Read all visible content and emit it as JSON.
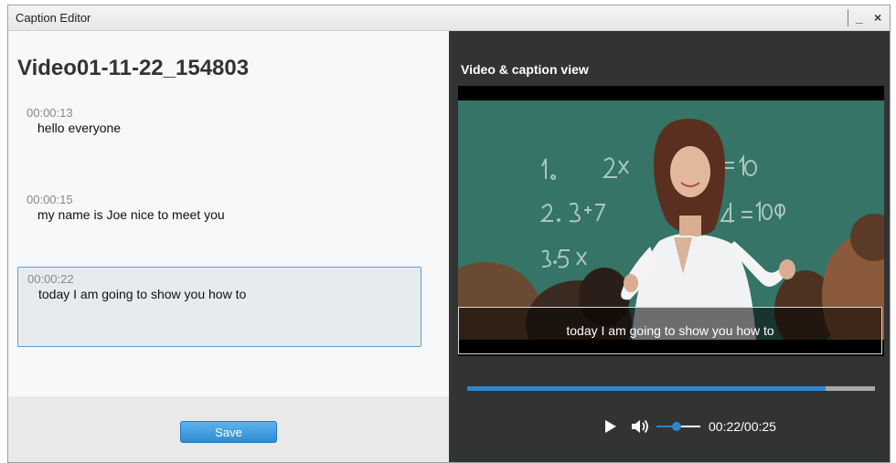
{
  "window": {
    "title": "Caption Editor",
    "minimize_label": "_",
    "close_label": "×"
  },
  "editor": {
    "video_title": "Video01-11-22_154803",
    "captions": [
      {
        "time": "00:00:13",
        "text": "hello everyone"
      },
      {
        "time": "00:00:15",
        "text": "my name is Joe nice to meet you"
      },
      {
        "time": "00:00:22",
        "text": "today I am going to show you how to",
        "selected": true
      }
    ],
    "save_label": "Save"
  },
  "preview": {
    "heading": "Video & caption view",
    "caption_overlay": "today I am going to show you how to",
    "progress_fraction": 0.88,
    "volume_fraction": 0.45,
    "time_display": "00:22/00:25"
  },
  "colors": {
    "accent": "#2c86cd",
    "dark_panel": "#323333",
    "save_button": "#3b9be0"
  }
}
